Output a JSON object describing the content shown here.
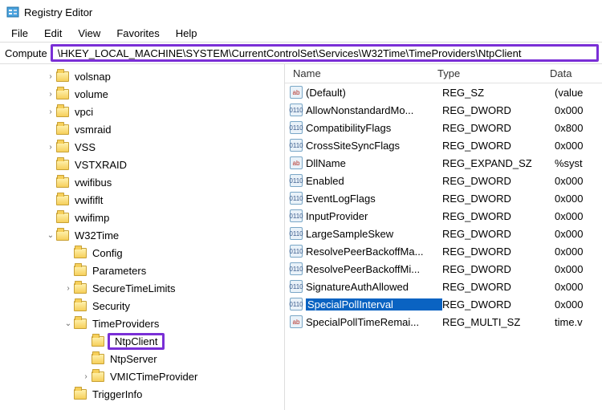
{
  "title": "Registry Editor",
  "menu": {
    "file": "File",
    "edit": "Edit",
    "view": "View",
    "favorites": "Favorites",
    "help": "Help"
  },
  "address": {
    "label": "Compute",
    "path": "\\HKEY_LOCAL_MACHINE\\SYSTEM\\CurrentControlSet\\Services\\W32Time\\TimeProviders\\NtpClient"
  },
  "tree": [
    {
      "indent": 56,
      "twisty": ">",
      "label": "volsnap"
    },
    {
      "indent": 56,
      "twisty": ">",
      "label": "volume"
    },
    {
      "indent": 56,
      "twisty": ">",
      "label": "vpci"
    },
    {
      "indent": 56,
      "twisty": "",
      "label": "vsmraid"
    },
    {
      "indent": 56,
      "twisty": ">",
      "label": "VSS"
    },
    {
      "indent": 56,
      "twisty": "",
      "label": "VSTXRAID"
    },
    {
      "indent": 56,
      "twisty": "",
      "label": "vwifibus"
    },
    {
      "indent": 56,
      "twisty": "",
      "label": "vwififlt"
    },
    {
      "indent": 56,
      "twisty": "",
      "label": "vwifimp"
    },
    {
      "indent": 56,
      "twisty": "v",
      "label": "W32Time"
    },
    {
      "indent": 78,
      "twisty": "",
      "label": "Config"
    },
    {
      "indent": 78,
      "twisty": "",
      "label": "Parameters"
    },
    {
      "indent": 78,
      "twisty": ">",
      "label": "SecureTimeLimits"
    },
    {
      "indent": 78,
      "twisty": "",
      "label": "Security"
    },
    {
      "indent": 78,
      "twisty": "v",
      "label": "TimeProviders"
    },
    {
      "indent": 100,
      "twisty": "",
      "label": "NtpClient",
      "selected": true
    },
    {
      "indent": 100,
      "twisty": "",
      "label": "NtpServer"
    },
    {
      "indent": 100,
      "twisty": ">",
      "label": "VMICTimeProvider"
    },
    {
      "indent": 78,
      "twisty": "",
      "label": "TriggerInfo"
    }
  ],
  "columns": {
    "name": "Name",
    "type": "Type",
    "data": "Data"
  },
  "values": [
    {
      "icon": "str",
      "name": "(Default)",
      "type": "REG_SZ",
      "data": "(value"
    },
    {
      "icon": "bin",
      "name": "AllowNonstandardMo...",
      "type": "REG_DWORD",
      "data": "0x000"
    },
    {
      "icon": "bin",
      "name": "CompatibilityFlags",
      "type": "REG_DWORD",
      "data": "0x800"
    },
    {
      "icon": "bin",
      "name": "CrossSiteSyncFlags",
      "type": "REG_DWORD",
      "data": "0x000"
    },
    {
      "icon": "str",
      "name": "DllName",
      "type": "REG_EXPAND_SZ",
      "data": "%syst"
    },
    {
      "icon": "bin",
      "name": "Enabled",
      "type": "REG_DWORD",
      "data": "0x000"
    },
    {
      "icon": "bin",
      "name": "EventLogFlags",
      "type": "REG_DWORD",
      "data": "0x000"
    },
    {
      "icon": "bin",
      "name": "InputProvider",
      "type": "REG_DWORD",
      "data": "0x000"
    },
    {
      "icon": "bin",
      "name": "LargeSampleSkew",
      "type": "REG_DWORD",
      "data": "0x000"
    },
    {
      "icon": "bin",
      "name": "ResolvePeerBackoffMa...",
      "type": "REG_DWORD",
      "data": "0x000"
    },
    {
      "icon": "bin",
      "name": "ResolvePeerBackoffMi...",
      "type": "REG_DWORD",
      "data": "0x000"
    },
    {
      "icon": "bin",
      "name": "SignatureAuthAllowed",
      "type": "REG_DWORD",
      "data": "0x000"
    },
    {
      "icon": "bin",
      "name": "SpecialPollInterval",
      "type": "REG_DWORD",
      "data": "0x000",
      "selected": true
    },
    {
      "icon": "str",
      "name": "SpecialPollTimeRemai...",
      "type": "REG_MULTI_SZ",
      "data": "time.v"
    }
  ],
  "glyph": {
    "str": "ab",
    "bin": "011\n110"
  }
}
